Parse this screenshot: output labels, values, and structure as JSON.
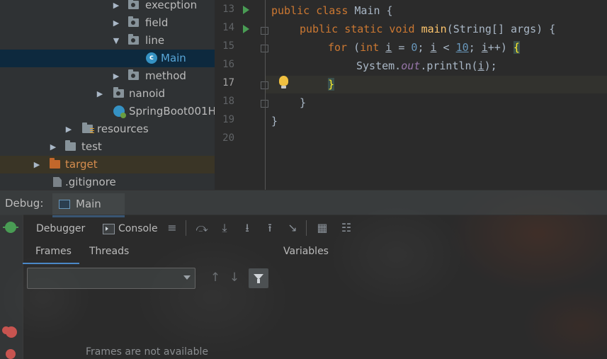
{
  "project_tree": {
    "items": [
      {
        "label": "execption",
        "type": "package"
      },
      {
        "label": "field",
        "type": "package"
      },
      {
        "label": "line",
        "type": "package"
      },
      {
        "label": "Main",
        "type": "class"
      },
      {
        "label": "method",
        "type": "package"
      },
      {
        "label": "nanoid",
        "type": "package"
      },
      {
        "label": "SpringBoot001H",
        "type": "class"
      },
      {
        "label": "resources",
        "type": "folder"
      },
      {
        "label": "test",
        "type": "folder"
      },
      {
        "label": "target",
        "type": "folder"
      },
      {
        "label": ".gitignore",
        "type": "file"
      }
    ]
  },
  "editor": {
    "line_numbers": [
      "13",
      "14",
      "15",
      "16",
      "17",
      "18",
      "19",
      "20"
    ],
    "code": {
      "l13": {
        "kw": "public class ",
        "rest": "Main {"
      },
      "l14": {
        "kw": "public static void ",
        "fn": "main",
        "rest": "(String[] args) {"
      },
      "l15": {
        "kw": "for ",
        "p1": "(",
        "kw2": "int ",
        "v1": "i",
        "p2": " = ",
        "n1": "0",
        "p3": "; ",
        "v2": "i",
        "p4": " < ",
        "n2": "10",
        "p5": "; ",
        "v3": "i",
        "p6": "++) ",
        "brace": "{"
      },
      "l16": {
        "p1": "System.",
        "out": "out",
        "p2": ".println(",
        "v": "i",
        "p3": ");"
      },
      "l17": {
        "brace": "}"
      },
      "l18": {
        "rest": "}"
      },
      "l19": {
        "rest": "}"
      }
    }
  },
  "debug": {
    "title": "Debug:",
    "tab_label": "Main",
    "debugger_tab": "Debugger",
    "console_tab": "Console",
    "frames_tab": "Frames",
    "threads_tab": "Threads",
    "variables_label": "Variables",
    "frames_empty": "Frames are not available"
  },
  "colors": {
    "keyword": "#cc7832",
    "function": "#ffc66d",
    "number": "#6897bb",
    "static_field": "#9876aa",
    "selection": "#0d293e",
    "accent": "#4a88c7"
  }
}
